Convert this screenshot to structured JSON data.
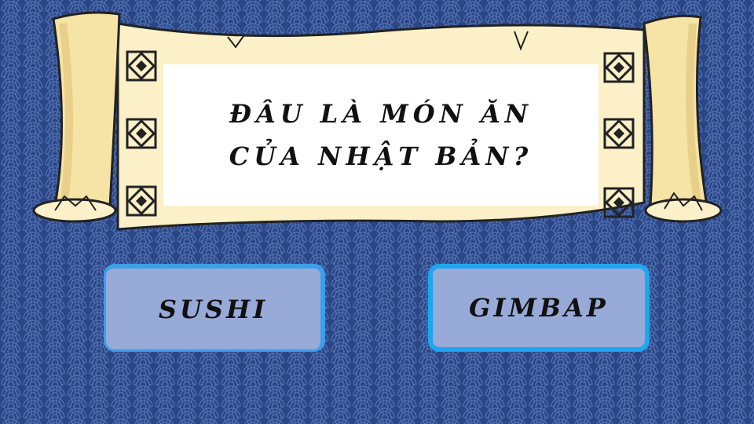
{
  "colors": {
    "background": "#2b4685",
    "wave": "#5272b5",
    "parchment": "#fbf0c8",
    "parchment_shadow": "#eadca4",
    "question_panel": "#ffffff",
    "answer_fill": "#98aad8",
    "answer_border": "#3d9fea"
  },
  "question": {
    "line1": "ĐÂU LÀ MÓN ĂN",
    "line2": "CỦA NHẬT BẢN?"
  },
  "answers": [
    {
      "label": "SUSHI"
    },
    {
      "label": "GIMBAP"
    }
  ],
  "decorations": {
    "left_icons": [
      "ornament-icon",
      "ornament-icon",
      "ornament-icon"
    ],
    "right_icons": [
      "ornament-icon",
      "ornament-icon",
      "ornament-icon"
    ]
  }
}
